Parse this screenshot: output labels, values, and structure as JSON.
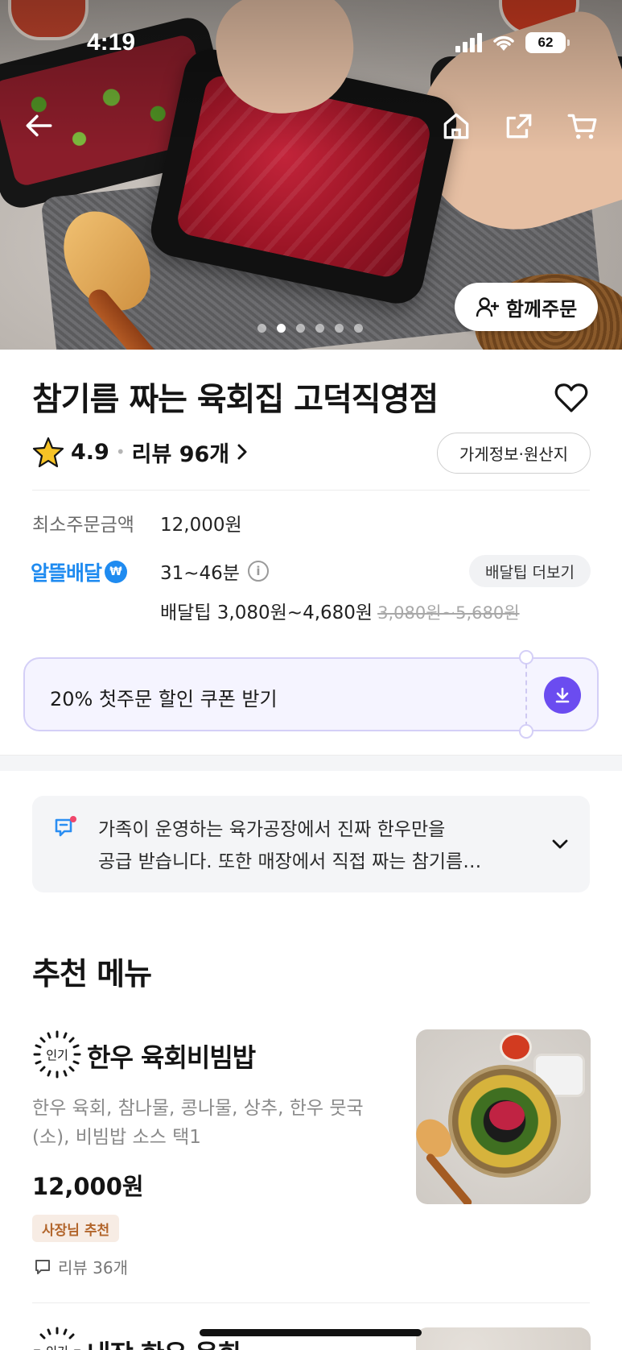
{
  "status_bar": {
    "time": "4:19",
    "battery": "62"
  },
  "hero": {
    "together_order_label": "함께주문",
    "carousel_total": 6,
    "carousel_active": 2,
    "icons": [
      "back-arrow-icon",
      "home-icon",
      "share-icon",
      "cart-icon"
    ]
  },
  "store": {
    "name": "참기름 짜는 육회집 고덕직영점",
    "rating": "4.9",
    "review_label": "리뷰 96개",
    "info_origin_label": "가게정보·원산지",
    "min_order_label": "최소주문금액",
    "min_order_value": "12,000원",
    "delivery_brand": "알뜰배달",
    "delivery_time": "31~46분",
    "tip_more_label": "배달팁 더보기",
    "delivery_tip": "배달팁 3,080원~4,680원",
    "delivery_tip_old": "3,080원~5,680원"
  },
  "coupon": {
    "label": "20% 첫주문 할인 쿠폰 받기"
  },
  "notice": {
    "line1": "가족이 운영하는 육가공장에서 진짜 한우만을",
    "line2": "공급 받습니다. 또한 매장에서 직접 짜는 참기름…"
  },
  "recommended": {
    "title": "추천 메뉴",
    "items": [
      {
        "badge": "인기",
        "name": "한우 육회비빔밥",
        "desc": "한우 육회, 참나물, 콩나물, 상추, 한우 뭇국(소), 비빔밥 소스 택1",
        "price": "12,000원",
        "tag": "사장님 추천",
        "reviews": "리뷰 36개"
      },
      {
        "badge": "인기",
        "name": "내장 한우 육회"
      }
    ]
  },
  "colors": {
    "brand_blue": "#1f8bf0",
    "coupon_purple": "#6b4cf0",
    "owner_tag_text": "#b2652b"
  }
}
